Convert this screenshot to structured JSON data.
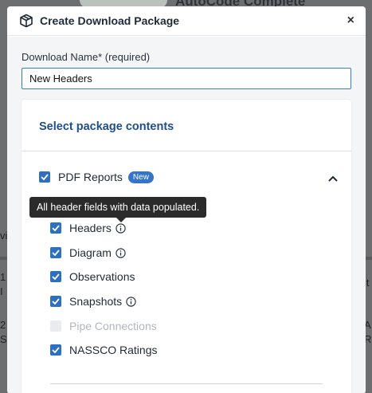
{
  "background": {
    "title": "AutoCode Complete",
    "left_fragments": [
      "vi",
      "1",
      "I",
      "2",
      "S"
    ],
    "right_fragments": [
      "it",
      "A",
      "R",
      "A",
      "R"
    ]
  },
  "modal": {
    "title": "Create Download Package",
    "close_label": "×",
    "name_label": "Download Name* (required)",
    "name_value": "New Headers",
    "section_heading": "Select package contents",
    "pdf_reports": {
      "label": "PDF Reports",
      "badge": "New",
      "checked": true,
      "expanded": true
    },
    "options": [
      {
        "label": "Headers",
        "checked": true,
        "disabled": false,
        "info": true
      },
      {
        "label": "Diagram",
        "checked": true,
        "disabled": false,
        "info": true
      },
      {
        "label": "Observations",
        "checked": true,
        "disabled": false,
        "info": false
      },
      {
        "label": "Snapshots",
        "checked": true,
        "disabled": false,
        "info": true
      },
      {
        "label": "Pipe Connections",
        "checked": false,
        "disabled": true,
        "info": false
      },
      {
        "label": "NASSCO Ratings",
        "checked": true,
        "disabled": false,
        "info": false
      }
    ],
    "tooltip": "All header fields with data populated."
  },
  "colors": {
    "accent": "#2f6fc0",
    "heading": "#1e4e8c",
    "badge": "#3574cc",
    "tooltip_bg": "#2b2b2b",
    "overlay": "#6d6e70"
  }
}
